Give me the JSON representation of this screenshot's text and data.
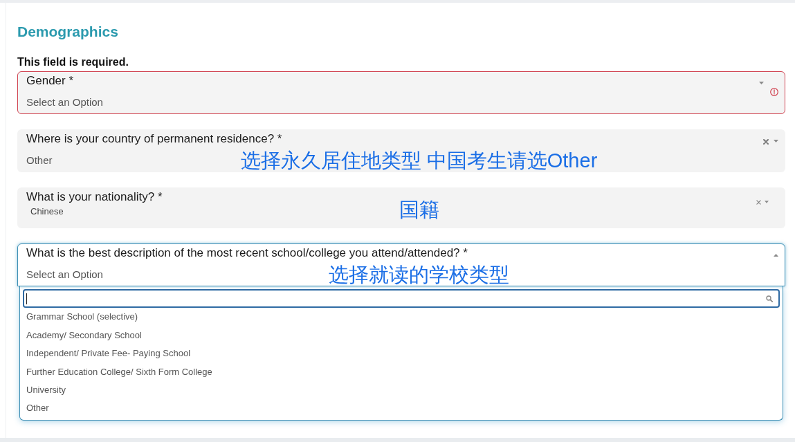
{
  "section": {
    "title": "Demographics"
  },
  "fields": [
    {
      "kind": "select",
      "label": "Gender *",
      "placeholder": "Select an Option",
      "error": true,
      "error_message": "This field is required.",
      "clearable": false,
      "expanded": false
    },
    {
      "kind": "select",
      "label": "Where is your country of permanent residence? *",
      "value": "Other",
      "error": false,
      "clearable": true,
      "expanded": false,
      "annotation": "选择永久居住地类型 中国考生请选Other"
    },
    {
      "kind": "combobox",
      "label": "What is your nationality? *",
      "value": "Chinese",
      "error": false,
      "clearable": true,
      "expanded": false,
      "annotation": "国籍"
    },
    {
      "kind": "select",
      "label": "What is the best description of the most recent school/college you attend/attended? *",
      "placeholder": "Select an Option",
      "error": false,
      "clearable": false,
      "expanded": true,
      "annotation": "选择就读的学校类型",
      "dropdown": {
        "search": {
          "focused": true
        },
        "options": [
          {
            "label": "Grammar School (selective)",
            "selected": false
          },
          {
            "label": "Academy/ Secondary School",
            "selected": false
          },
          {
            "label": "Independent/ Private Fee- Paying School",
            "selected": false
          },
          {
            "label": "Further Education College/ Sixth Form College",
            "selected": false
          },
          {
            "label": "University",
            "selected": false
          },
          {
            "label": "Other",
            "selected": false
          }
        ]
      }
    }
  ]
}
